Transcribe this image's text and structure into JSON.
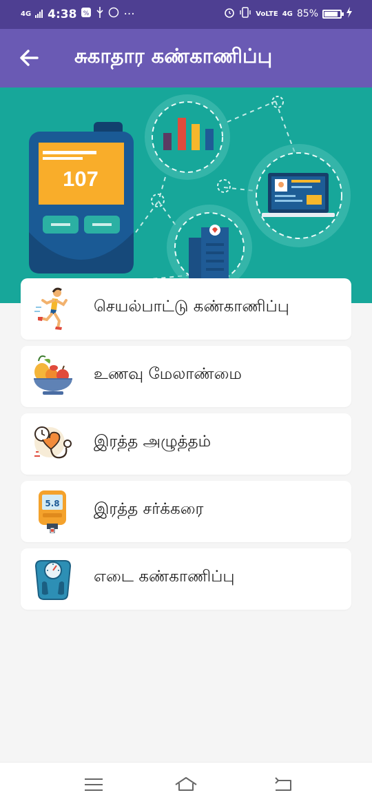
{
  "status_bar": {
    "network_left": "4G",
    "time": "4:38",
    "dots": "···",
    "network_right": "4G",
    "volte": "VoLTE",
    "battery_percent": "85%",
    "battery_level": 0.85
  },
  "app_bar": {
    "back_icon": "arrow-left-icon",
    "title": "சுகாதார கண்காணிப்பு"
  },
  "banner": {
    "device_reading": "107"
  },
  "menu": {
    "items": [
      {
        "label": "செயல்பாட்டு கண்காணிப்பு",
        "icon": "running-man-icon"
      },
      {
        "label": "உணவு மேலாண்மை",
        "icon": "fruit-bowl-icon"
      },
      {
        "label": "இரத்த அழுத்தம்",
        "icon": "heart-stethoscope-icon"
      },
      {
        "label": "இரத்த சர்க்கரை",
        "icon": "glucometer-icon"
      },
      {
        "label": "எடை கண்காணிப்பு",
        "icon": "weighing-scale-icon"
      }
    ],
    "glucometer_reading": "5.8"
  },
  "nav_bar": {
    "menu_icon": "menu-icon",
    "home_icon": "home-icon",
    "back_icon": "back-icon"
  }
}
